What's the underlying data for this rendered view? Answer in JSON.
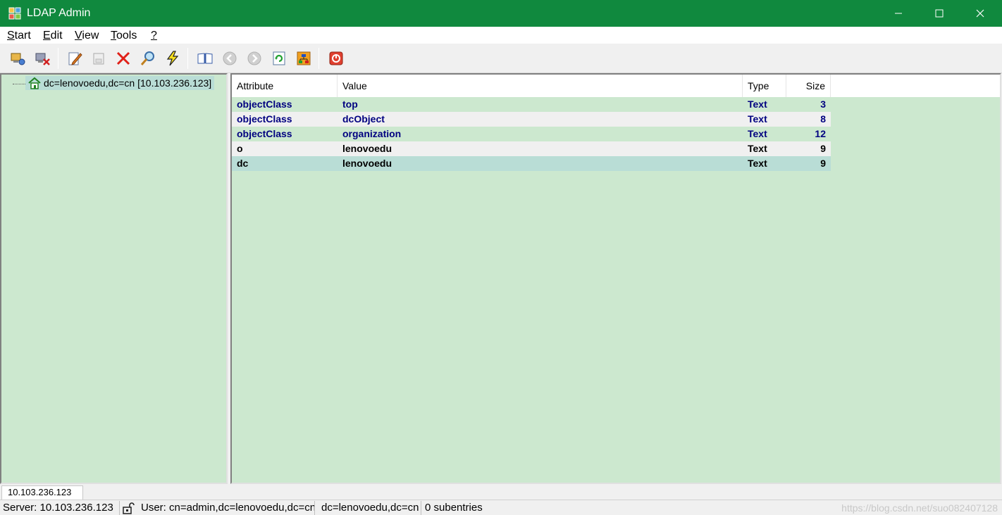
{
  "window": {
    "title": "LDAP Admin",
    "icon": "ldap-admin-app-icon",
    "controls": [
      "minimize-icon",
      "maximize-icon",
      "close-icon"
    ],
    "title_bar_color": "#10893e"
  },
  "menu": {
    "items": [
      {
        "accel": "S",
        "rest": "tart"
      },
      {
        "accel": "E",
        "rest": "dit"
      },
      {
        "accel": "V",
        "rest": "iew"
      },
      {
        "accel": "T",
        "rest": "ools"
      },
      {
        "accel": "?",
        "rest": ""
      }
    ]
  },
  "toolbar": {
    "buttons": [
      "connect-icon",
      "disconnect-icon",
      "edit-entry-icon",
      "save-entry-icon",
      "delete-icon",
      "search-icon",
      "run-icon",
      "address-book-icon",
      "back-icon",
      "forward-icon",
      "refresh-icon",
      "schema-icon",
      "exit-icon"
    ]
  },
  "tree": {
    "root": {
      "label": "dc=lenovoedu,dc=cn [10.103.236.123]",
      "icon": "home-entry-icon"
    }
  },
  "list": {
    "columns": {
      "attribute": "Attribute",
      "value": "Value",
      "type": "Type",
      "size": "Size"
    },
    "rows": [
      {
        "attribute": "objectClass",
        "value": "top",
        "type": "Text",
        "size": "3"
      },
      {
        "attribute": "objectClass",
        "value": "dcObject",
        "type": "Text",
        "size": "8"
      },
      {
        "attribute": "objectClass",
        "value": "organization",
        "type": "Text",
        "size": "12"
      },
      {
        "attribute": "o",
        "value": "lenovoedu",
        "type": "Text",
        "size": "9"
      },
      {
        "attribute": "dc",
        "value": "lenovoedu",
        "type": "Text",
        "size": "9"
      }
    ],
    "colors": {
      "background": "#cce8cf",
      "selected_row": "#b9ddd6",
      "objectclass_text": "#000080"
    }
  },
  "tabs": [
    "10.103.236.123"
  ],
  "status": {
    "server": "Server: 10.103.236.123",
    "lock_icon": "lock-icon",
    "user": "User: cn=admin,dc=lenovoedu,dc=cn",
    "dn": "dc=lenovoedu,dc=cn",
    "subentries": "0 subentries",
    "watermark": "https://blog.csdn.net/suo082407128"
  }
}
